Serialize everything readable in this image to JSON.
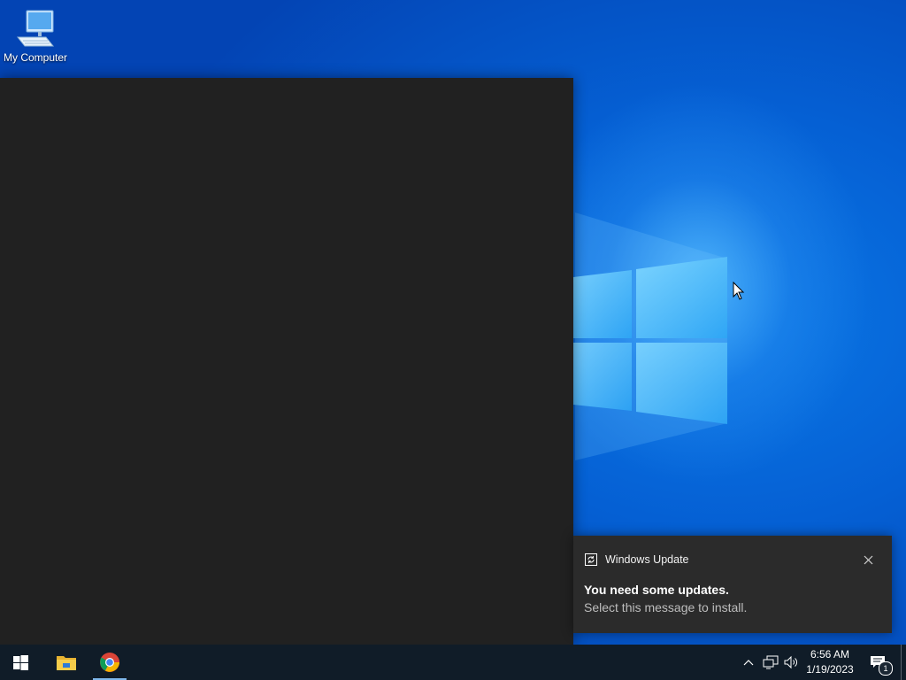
{
  "desktop": {
    "icons": [
      {
        "label": "My Computer",
        "icon": "computer-icon"
      }
    ],
    "background_colors": {
      "deep": "#0344b4",
      "mid": "#0560d4",
      "glow": "#5abeff"
    }
  },
  "dark_window": {
    "color": "#212121"
  },
  "toast": {
    "app_name": "Windows Update",
    "app_icon": "update-icon",
    "title": "You need some updates.",
    "body": "Select this message to install.",
    "close_icon": "close-icon",
    "background": "#2b2b2b"
  },
  "taskbar": {
    "background": "#101c28",
    "start_icon": "windows-start-icon",
    "pinned": [
      {
        "name": "File Explorer",
        "icon": "file-explorer-icon"
      },
      {
        "name": "Google Chrome",
        "icon": "chrome-icon",
        "active": true
      }
    ],
    "tray": {
      "icons": [
        "show-hidden-icons-chevron",
        "network-icon",
        "volume-icon"
      ],
      "time": "6:56 AM",
      "date": "1/19/2023",
      "notification_count": "1"
    }
  }
}
